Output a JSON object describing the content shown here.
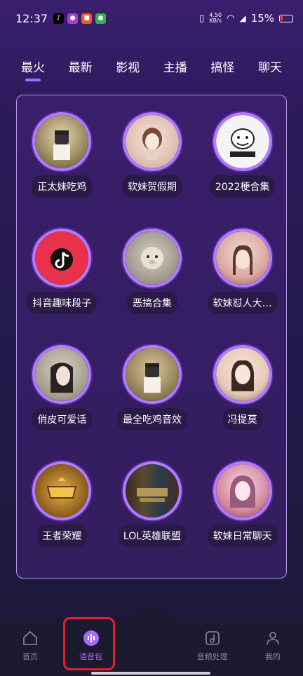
{
  "status_bar": {
    "time": "12:37",
    "net_speed_value": "4.50",
    "net_speed_unit": "KB/s",
    "battery": "15%"
  },
  "tabs": [
    {
      "label": "最火",
      "active": true
    },
    {
      "label": "最新",
      "active": false
    },
    {
      "label": "影视",
      "active": false
    },
    {
      "label": "主播",
      "active": false
    },
    {
      "label": "搞怪",
      "active": false
    },
    {
      "label": "聊天",
      "active": false
    }
  ],
  "items": [
    {
      "label": "正太妹吃鸡",
      "thumb_color": "#c9b27a"
    },
    {
      "label": "软妹贺假期",
      "thumb_color": "#e8d2c6"
    },
    {
      "label": "2022梗合集",
      "thumb_color": "#f2f2f2"
    },
    {
      "label": "抖音趣味段子",
      "thumb_color": "#e8314a"
    },
    {
      "label": "恶搞合集",
      "thumb_color": "#b9b0a0"
    },
    {
      "label": "软妹怼人大…",
      "thumb_color": "#d9a7a0"
    },
    {
      "label": "俏皮可爱话",
      "thumb_color": "#b8b0a2"
    },
    {
      "label": "最全吃鸡音效",
      "thumb_color": "#a89a70"
    },
    {
      "label": "冯提莫",
      "thumb_color": "#e6c8b8"
    },
    {
      "label": "王者荣耀",
      "thumb_color": "#c4902a"
    },
    {
      "label": "LOL英雄联盟",
      "thumb_color": "#2a3a4a"
    },
    {
      "label": "软妹日常聊天",
      "thumb_color": "#d48aa0"
    }
  ],
  "bottom_nav": [
    {
      "label": "首页",
      "icon": "home-icon",
      "active": false
    },
    {
      "label": "语音包",
      "icon": "voice-pack-icon",
      "active": true
    },
    {
      "label": "",
      "icon": "",
      "active": false
    },
    {
      "label": "音频处理",
      "icon": "music-note-icon",
      "active": false
    },
    {
      "label": "我的",
      "icon": "user-icon",
      "active": false
    }
  ],
  "colors": {
    "accent": "#a46cff",
    "highlight": "#e0222a"
  }
}
